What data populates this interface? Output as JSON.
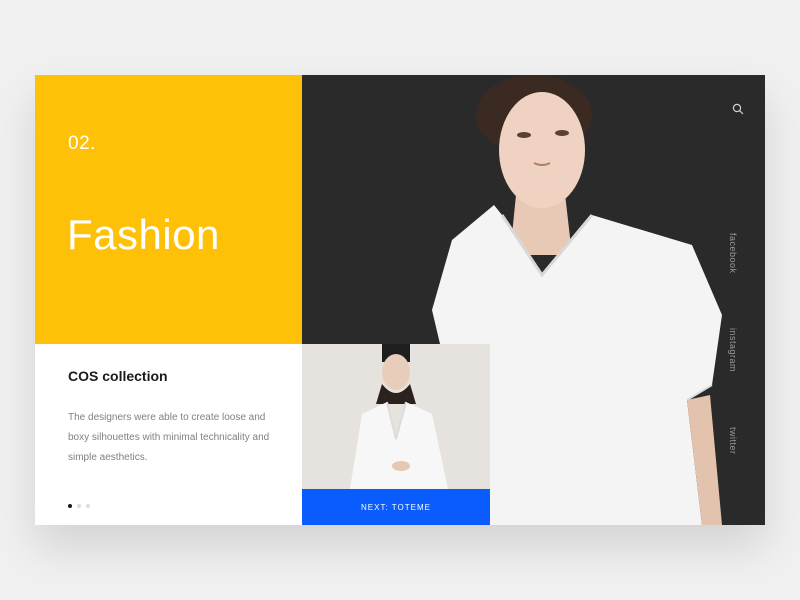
{
  "section": {
    "number": "02.",
    "title": "Fashion"
  },
  "collection": {
    "title": "COS collection",
    "description": "The designers were able to create loose and boxy silhouettes with minimal technicality and simple aesthetics."
  },
  "pagination": {
    "total": 3,
    "active": 1
  },
  "social": {
    "facebook": "facebook",
    "instagram": "instagram",
    "twitter": "twitter"
  },
  "next": {
    "label": "NEXT: TOTEME"
  },
  "icons": {
    "search": "search-icon"
  },
  "colors": {
    "accent_yellow": "#ffc107",
    "dark_panel": "#2a2a2a",
    "next_blue": "#0a5cff"
  }
}
